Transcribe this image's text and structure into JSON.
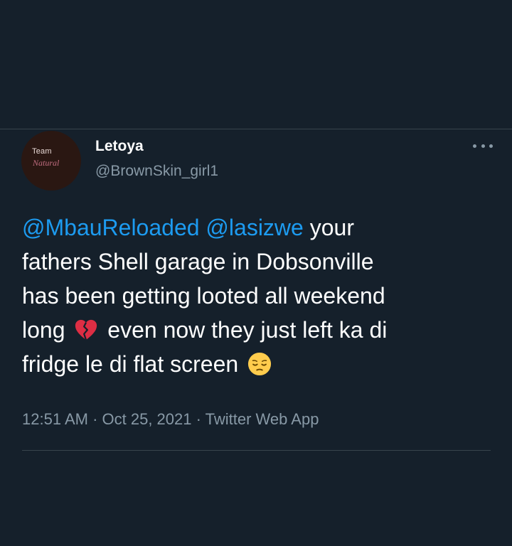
{
  "tweet": {
    "avatar_text": {
      "line1": "Team",
      "line2": "Natural"
    },
    "display_name": "Letoya",
    "handle": "@BrownSkin_girl1",
    "more_icon": "more-dots-icon",
    "text": {
      "mention1": "@MbauReloaded",
      "mention2": "@lasizwe",
      "line1_rest": " your",
      "line2": "fathers Shell garage in Dobsonville",
      "line3": "has been getting looted all weekend",
      "line4_start": "long ",
      "line4_end": " even now they just left ka di",
      "line5": "fridge le di flat screen ",
      "emoji1": "broken-heart-emoji",
      "emoji2": "pensive-face-emoji"
    },
    "meta": {
      "time": "12:51 AM",
      "separator1": " · ",
      "date": "Oct 25, 2021",
      "separator2": " · ",
      "source": "Twitter Web App"
    }
  },
  "colors": {
    "background": "#15202b",
    "mention": "#1d9bf0",
    "secondary_text": "#8899a6",
    "divider": "#38444d"
  }
}
